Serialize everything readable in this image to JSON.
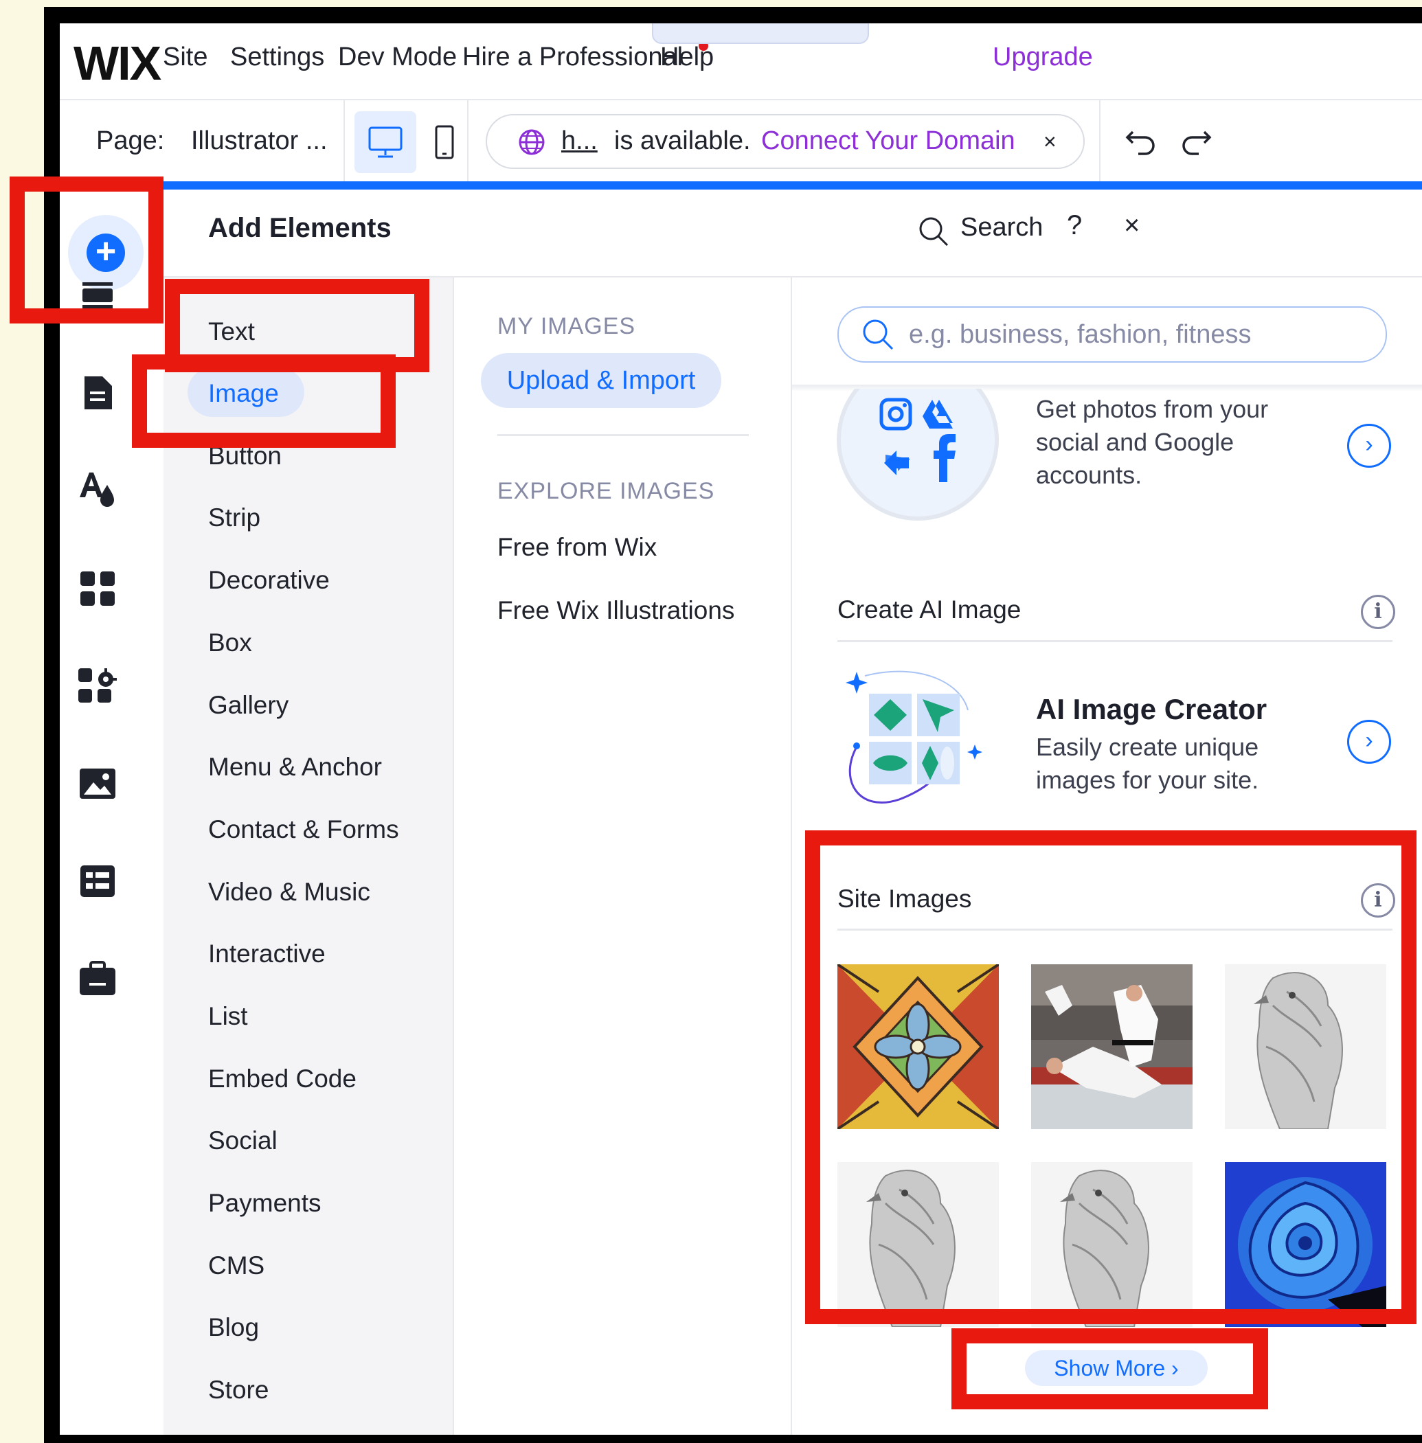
{
  "topbar": {
    "logo": "WIX",
    "menu": [
      "Site",
      "Settings",
      "Dev Mode",
      "Hire a Professional",
      "Help"
    ],
    "collapse_glyph": "ˆ",
    "upgrade": "Upgrade"
  },
  "pagebar": {
    "page_label": "Page:",
    "page_name": "Illustrator ...",
    "domain_name": "h...",
    "domain_status": "is available.",
    "connect_link": "Connect Your Domain",
    "close_glyph": "×"
  },
  "panel": {
    "title": "Add Elements",
    "search_label": "Search",
    "help_glyph": "?",
    "close_glyph": "×",
    "categories": [
      "Text",
      "Image",
      "Button",
      "Strip",
      "Decorative",
      "Box",
      "Gallery",
      "Menu & Anchor",
      "Contact & Forms",
      "Video & Music",
      "Interactive",
      "List",
      "Embed Code",
      "Social",
      "Payments",
      "CMS",
      "Blog",
      "Store"
    ],
    "selected_category": "Image",
    "my_images_heading": "MY IMAGES",
    "upload_button": "Upload & Import",
    "explore_heading": "EXPLORE IMAGES",
    "explore_links": [
      "Free from Wix",
      "Free Wix Illustrations"
    ],
    "search_placeholder": "e.g. business, fashion, fitness",
    "social_card_text": [
      "Get photos from your",
      "social and Google",
      "accounts."
    ],
    "ai_section_title": "Create AI Image",
    "ai_card_title": "AI Image Creator",
    "ai_card_text": [
      "Easily create unique",
      "images for your site."
    ],
    "site_images_title": "Site Images",
    "show_more": "Show More ›",
    "info_glyph": "i",
    "arrow_glyph": "›"
  },
  "colors": {
    "accent": "#116dff",
    "upgrade_purple": "#8c2fd6",
    "highlight_red": "#e8190f",
    "notification_red": "#e2191e"
  },
  "icons": {
    "rail": [
      "add-icon",
      "sections-icon",
      "pages-icon",
      "design-icon",
      "apps-icon",
      "business-apps-icon",
      "media-icon",
      "cms-icon",
      "portfolio-icon"
    ]
  }
}
